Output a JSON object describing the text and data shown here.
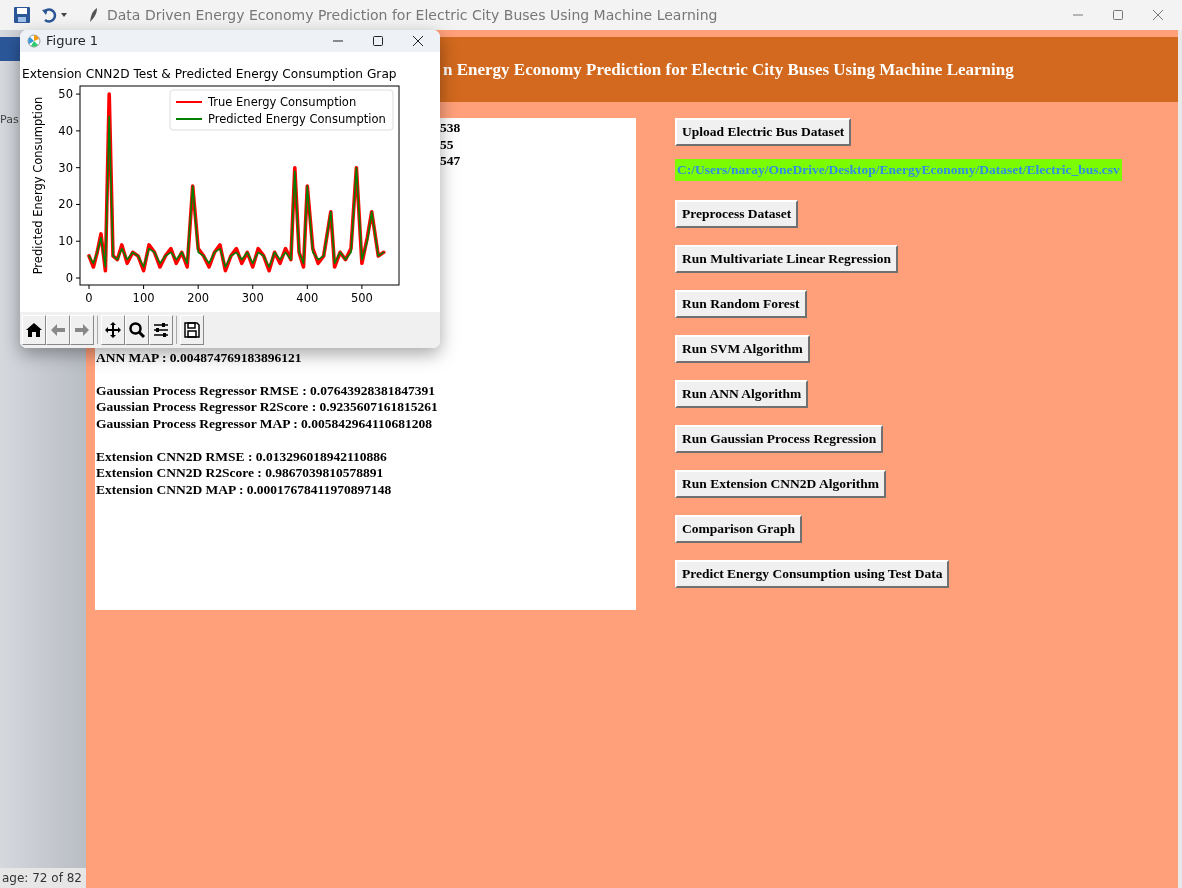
{
  "word": {
    "ribbon_label": "Pas",
    "status_bar": "age: 72 of 82"
  },
  "window": {
    "title": "Data Driven Energy Economy Prediction for Electric City Buses Using Machine Learning",
    "heading": "n Energy Economy Prediction for Electric City Buses Using Machine Learning"
  },
  "output": {
    "partial_lines": [
      "538",
      "55",
      "547"
    ],
    "groups": [
      [
        "ANN MAP : 0.004874769183896121"
      ],
      [
        "Gaussian Process Regressor RMSE : 0.07643928381847391",
        "Gaussian Process Regressor R2Score : 0.9235607161815261",
        "Gaussian Process Regressor MAP : 0.005842964110681208"
      ],
      [
        "Extension CNN2D RMSE : 0.013296018942110886",
        "Extension CNN2D R2Score : 0.9867039810578891",
        "Extension CNN2D MAP : 0.00017678411970897148"
      ]
    ]
  },
  "actions": [
    {
      "kind": "button",
      "text": "Upload Electric Bus Dataset"
    },
    {
      "kind": "path",
      "text": "C:/Users/naray/OneDrive/Desktop/EnergyEconomy/Dataset/Electric_bus.csv"
    },
    {
      "kind": "button",
      "text": "Preprocess Dataset"
    },
    {
      "kind": "button",
      "text": "Run Multivariate Linear Regression"
    },
    {
      "kind": "button",
      "text": "Run Random Forest"
    },
    {
      "kind": "button",
      "text": "Run SVM Algorithm"
    },
    {
      "kind": "button",
      "text": "Run ANN Algorithm"
    },
    {
      "kind": "button",
      "text": "Run Gaussian Process Regression"
    },
    {
      "kind": "button",
      "text": "Run Extension CNN2D Algorithm"
    },
    {
      "kind": "button",
      "text": "Comparison Graph"
    },
    {
      "kind": "button",
      "text": "Predict Energy Consumption using Test Data"
    }
  ],
  "figure": {
    "title": "Figure 1",
    "chart_data": {
      "type": "line",
      "title": "Extension CNN2D Test & Predicted Energy Consumption Grap",
      "ylabel": "Predicted Energy Consumption",
      "x": [
        0,
        8,
        15,
        22,
        30,
        37,
        44,
        52,
        60,
        70,
        80,
        90,
        100,
        110,
        120,
        130,
        140,
        150,
        160,
        170,
        180,
        190,
        200,
        210,
        220,
        230,
        240,
        250,
        260,
        270,
        280,
        290,
        300,
        310,
        320,
        330,
        340,
        350,
        360,
        370,
        377,
        385,
        393,
        400,
        410,
        420,
        430,
        443,
        450,
        460,
        470,
        480,
        490,
        500,
        510,
        518,
        530,
        540
      ],
      "series": [
        {
          "name": "True Energy Consumption",
          "color": "#ff0000",
          "values": [
            6,
            3,
            7,
            12,
            2,
            50,
            6,
            5,
            9,
            4,
            7,
            6,
            2,
            9,
            7,
            3,
            6,
            8,
            4,
            7,
            3,
            25,
            8,
            6,
            3,
            7,
            9,
            2,
            6,
            8,
            4,
            7,
            3,
            8,
            6,
            2,
            7,
            4,
            8,
            5,
            30,
            7,
            3,
            25,
            8,
            4,
            6,
            18,
            3,
            7,
            5,
            8,
            30,
            4,
            11,
            18,
            6,
            7
          ]
        },
        {
          "name": "Predicted Energy Consumption",
          "color": "#008000",
          "values": [
            6,
            4,
            7,
            11,
            3,
            44,
            6,
            5,
            8,
            5,
            7,
            6,
            3,
            8,
            7,
            4,
            6,
            7,
            5,
            7,
            4,
            25,
            7,
            6,
            4,
            7,
            8,
            3,
            6,
            7,
            5,
            7,
            4,
            7,
            6,
            3,
            7,
            5,
            7,
            5,
            29,
            7,
            4,
            25,
            7,
            5,
            6,
            18,
            4,
            7,
            5,
            7,
            30,
            5,
            10,
            18,
            6,
            7
          ]
        }
      ],
      "legend": "upper right",
      "xlim": [
        -16.5,
        568
      ],
      "ylim": [
        -1.9,
        52.2
      ],
      "xticks": [
        0,
        100,
        200,
        300,
        400,
        500
      ],
      "yticks": [
        0,
        10,
        20,
        30,
        40,
        50
      ]
    }
  }
}
